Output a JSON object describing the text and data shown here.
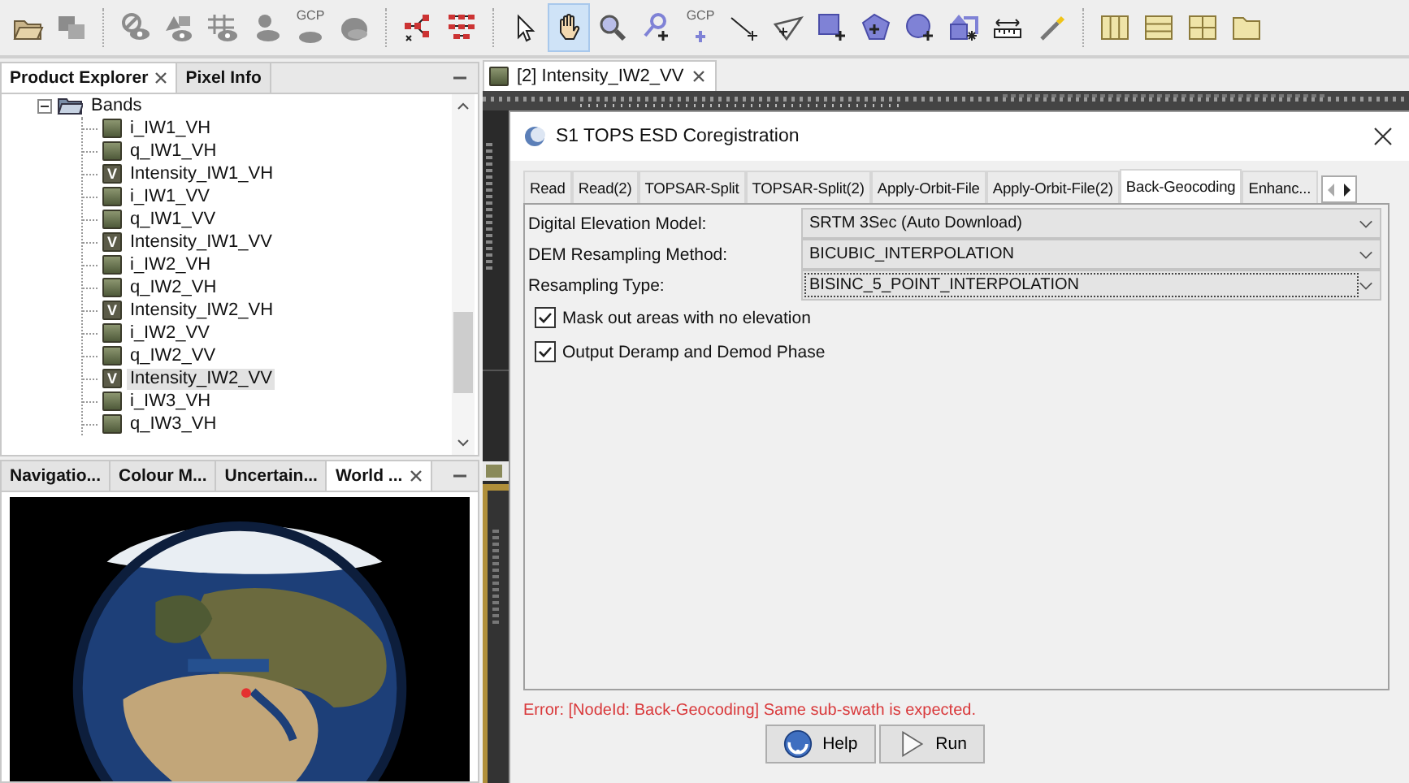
{
  "toolbar": {
    "groups": [
      [
        {
          "kind": "folder",
          "selected": false
        },
        {
          "kind": "windows",
          "selected": false
        }
      ],
      [
        {
          "kind": "eye-slash",
          "selected": false
        },
        {
          "kind": "shapes-eye",
          "selected": false
        },
        {
          "kind": "grid-eye",
          "selected": false
        },
        {
          "kind": "person-disc",
          "selected": false
        },
        {
          "kind": "gcp-disc",
          "label": "GCP",
          "selected": false
        },
        {
          "kind": "disc",
          "selected": false
        }
      ],
      [
        {
          "kind": "graph",
          "selected": false
        },
        {
          "kind": "network",
          "selected": false
        }
      ],
      [
        {
          "kind": "cursor",
          "selected": false
        },
        {
          "kind": "hand",
          "selected": true
        },
        {
          "kind": "zoom",
          "selected": false
        },
        {
          "kind": "pin-plus",
          "selected": false
        },
        {
          "kind": "gcp-plus",
          "label": "GCP",
          "selected": false
        },
        {
          "kind": "line-plus",
          "selected": false
        },
        {
          "kind": "polyline-plus",
          "selected": false
        },
        {
          "kind": "rect-plus",
          "selected": false
        },
        {
          "kind": "polygon-plus",
          "selected": false
        },
        {
          "kind": "circle-plus",
          "selected": false
        },
        {
          "kind": "shapes-star",
          "selected": false
        },
        {
          "kind": "ruler",
          "selected": false
        },
        {
          "kind": "wand",
          "selected": false
        }
      ],
      [
        {
          "kind": "columns",
          "selected": false
        },
        {
          "kind": "rows",
          "selected": false
        },
        {
          "kind": "tiles",
          "selected": false
        },
        {
          "kind": "folder-plain",
          "selected": false
        }
      ]
    ]
  },
  "top_panel": {
    "tabs": [
      {
        "label": "Product Explorer",
        "closable": true,
        "selected": true
      },
      {
        "label": "Pixel Info",
        "closable": false,
        "selected": false
      }
    ],
    "tree": [
      {
        "label": "Bands",
        "expanded": true,
        "children": [
          {
            "label": "i_IW1_VH",
            "kind": "band",
            "selected": false
          },
          {
            "label": "q_IW1_VH",
            "kind": "band",
            "selected": false
          },
          {
            "label": "Intensity_IW1_VH",
            "kind": "virtual",
            "mark": "V",
            "selected": false
          },
          {
            "label": "i_IW1_VV",
            "kind": "band",
            "selected": false
          },
          {
            "label": "q_IW1_VV",
            "kind": "band",
            "selected": false
          },
          {
            "label": "Intensity_IW1_VV",
            "kind": "virtual",
            "mark": "V",
            "selected": false
          },
          {
            "label": "i_IW2_VH",
            "kind": "band",
            "selected": false
          },
          {
            "label": "q_IW2_VH",
            "kind": "band",
            "selected": false
          },
          {
            "label": "Intensity_IW2_VH",
            "kind": "virtual",
            "mark": "V",
            "selected": false
          },
          {
            "label": "i_IW2_VV",
            "kind": "band",
            "selected": false
          },
          {
            "label": "q_IW2_VV",
            "kind": "band",
            "selected": false
          },
          {
            "label": "Intensity_IW2_VV",
            "kind": "virtual",
            "mark": "V",
            "selected": true
          },
          {
            "label": "i_IW3_VH",
            "kind": "band",
            "selected": false
          },
          {
            "label": "q_IW3_VH",
            "kind": "band",
            "selected": false
          }
        ]
      }
    ]
  },
  "bottom_panel": {
    "tabs": [
      {
        "label": "Navigatio...",
        "closable": false,
        "selected": false
      },
      {
        "label": "Colour M...",
        "closable": false,
        "selected": false
      },
      {
        "label": "Uncertain...",
        "closable": false,
        "selected": false
      },
      {
        "label": "World ...",
        "closable": true,
        "selected": true
      }
    ]
  },
  "image_tab": {
    "label": "[2] Intensity_IW2_VV"
  },
  "dialog": {
    "title": "S1 TOPS ESD Coregistration",
    "tabs": [
      {
        "label": "Read",
        "selected": false
      },
      {
        "label": "Read(2)",
        "selected": false
      },
      {
        "label": "TOPSAR-Split",
        "selected": false
      },
      {
        "label": "TOPSAR-Split(2)",
        "selected": false
      },
      {
        "label": "Apply-Orbit-File",
        "selected": false
      },
      {
        "label": "Apply-Orbit-File(2)",
        "selected": false
      },
      {
        "label": "Back-Geocoding",
        "selected": true
      },
      {
        "label": "Enhanc...",
        "selected": false
      }
    ],
    "fields": [
      {
        "label": "Digital Elevation Model:",
        "value": "SRTM 3Sec (Auto Download)",
        "focused": false
      },
      {
        "label": "DEM Resampling Method:",
        "value": "BICUBIC_INTERPOLATION",
        "focused": false
      },
      {
        "label": "Resampling Type:",
        "value": "BISINC_5_POINT_INTERPOLATION",
        "focused": true
      }
    ],
    "checkboxes": [
      {
        "label": "Mask out areas with no elevation",
        "checked": true
      },
      {
        "label": "Output Deramp and Demod Phase",
        "checked": true
      }
    ],
    "error": "Error: [NodeId: Back-Geocoding] Same sub-swath is expected.",
    "buttons": [
      {
        "label": "Help",
        "kind": "help"
      },
      {
        "label": "Run",
        "kind": "run"
      }
    ]
  }
}
